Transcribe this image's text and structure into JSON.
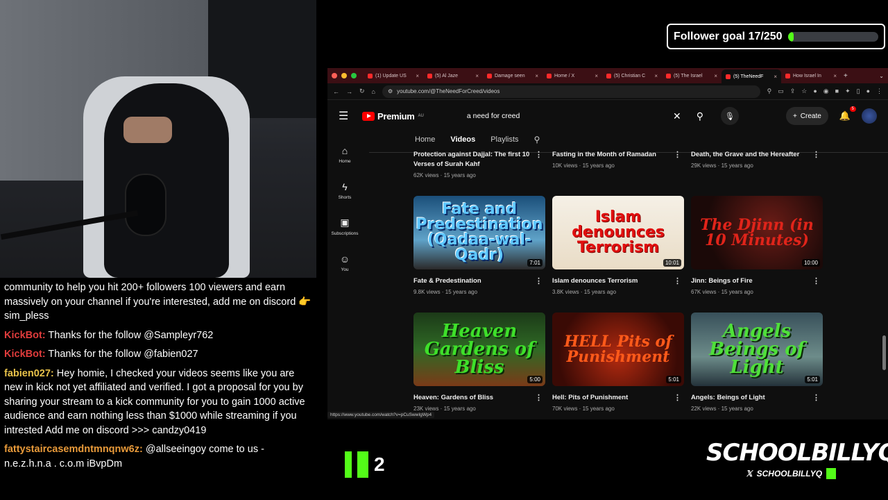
{
  "goal": {
    "label": "Follower goal 17/250",
    "current": 17,
    "target": 250
  },
  "chat": [
    {
      "user": "",
      "text": "community to help you hit 200+ followers 100 viewers and earn massively on your channel if you're interested, add me on discord 👉 sim_pless",
      "cls": ""
    },
    {
      "user": "KickBot:",
      "text": " Thanks for the follow @Sampleyr762",
      "cls": "u-kick"
    },
    {
      "user": "KickBot:",
      "text": " Thanks for the follow @fabien027",
      "cls": "u-kick"
    },
    {
      "user": "fabien027:",
      "text": " Hey homie, I checked your videos seems like you are new in kick not yet affiliated and verified. I got a proposal for you by sharing your stream to a kick community for you to gain 1000 active audience and earn nothing less than $1000 while streaming if you intrested Add me on discord >>> candzy0419",
      "cls": "u-fab"
    },
    {
      "user": "fattystaircasemdntmnqnw6z:",
      "text": " @allseeingoy come to us - n.e.z.h.n.a . c.o.m iBvpDm",
      "cls": "u-fat"
    }
  ],
  "viewers": "2",
  "brand": {
    "name": "SCHOOLBILLYQ",
    "handle": "SCHOOLBILLYQ"
  },
  "browser": {
    "tabs": [
      {
        "label": "(1) Update US",
        "active": false
      },
      {
        "label": "(5) Al Jaze",
        "active": false
      },
      {
        "label": "Damage seen",
        "active": false
      },
      {
        "label": "Home / X",
        "active": false
      },
      {
        "label": "(5) Christian C",
        "active": false
      },
      {
        "label": "(5) The Israel",
        "active": false
      },
      {
        "label": "(5) TheNeedF",
        "active": true
      },
      {
        "label": "How Israel In",
        "active": false
      }
    ],
    "url": "youtube.com/@TheNeedForCreed/videos",
    "status_url": "https://www.youtube.com/watch?v=pCuSwwIgWp4"
  },
  "yt": {
    "logo": "Premium",
    "region": "AU",
    "search_value": "a need for creed",
    "create_label": "Create",
    "notif_count": "5",
    "sidebar": [
      {
        "icon": "⌂",
        "label": "Home",
        "name": "sidebar-item-home"
      },
      {
        "icon": "ϟ",
        "label": "Shorts",
        "name": "sidebar-item-shorts"
      },
      {
        "icon": "▣",
        "label": "Subscriptions",
        "name": "sidebar-item-subscriptions"
      },
      {
        "icon": "☺",
        "label": "You",
        "name": "sidebar-item-you"
      }
    ],
    "channel_tabs": [
      "Home",
      "Videos",
      "Playlists"
    ],
    "top_row": [
      {
        "title": "Protection against Dajjal: The first 10 Verses of Surah Kahf",
        "meta": "62K views · 15 years ago"
      },
      {
        "title": "Fasting in the Month of Ramadan",
        "meta": "10K views · 15 years ago"
      },
      {
        "title": "Death, the Grave and the Hereafter",
        "meta": "29K views · 15 years ago"
      }
    ],
    "videos": [
      {
        "thumb_text": "Fate and Predestination (Qadaa-wal-Qadr)",
        "duration": "7:01",
        "title": "Fate & Predestination",
        "meta": "9.8K views · 15 years ago",
        "cls": "th-fate"
      },
      {
        "thumb_text": "Islam denounces Terrorism",
        "duration": "10:01",
        "title": "Islam denounces Terrorism",
        "meta": "3.8K views · 15 years ago",
        "cls": "th-islam"
      },
      {
        "thumb_text": "The Djinn (in 10 Minutes)",
        "duration": "10:00",
        "title": "Jinn: Beings of Fire",
        "meta": "67K views · 15 years ago",
        "cls": "th-djinn"
      },
      {
        "thumb_text": "Heaven Gardens of Bliss",
        "duration": "5:00",
        "title": "Heaven: Gardens of Bliss",
        "meta": "23K views · 15 years ago",
        "cls": "th-heaven"
      },
      {
        "thumb_text": "HELL Pits of Punishment",
        "duration": "5:01",
        "title": "Hell: Pits of Punishment",
        "meta": "70K views · 15 years ago",
        "cls": "th-hell"
      },
      {
        "thumb_text": "Angels Beings of Light",
        "duration": "5:01",
        "title": "Angels: Beings of Light",
        "meta": "22K views · 15 years ago",
        "cls": "th-angels"
      }
    ]
  }
}
